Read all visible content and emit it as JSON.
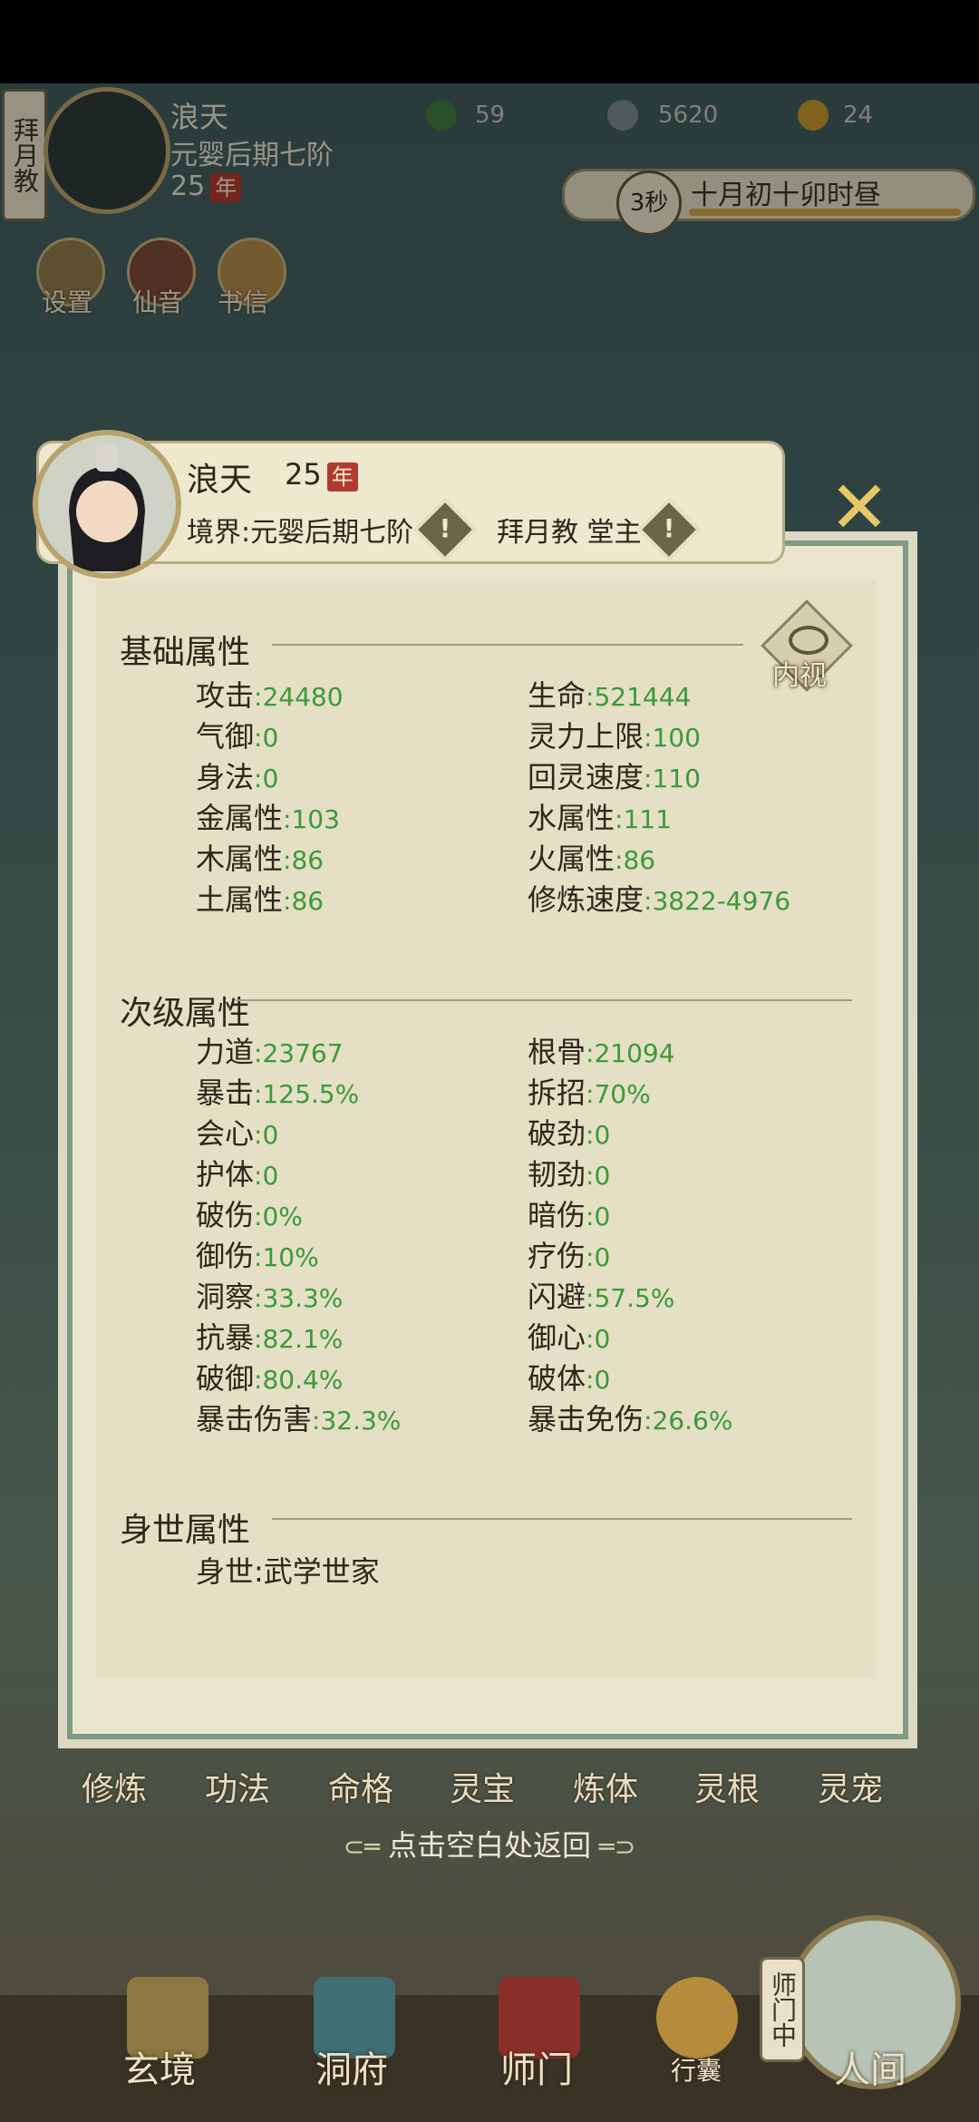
{
  "header": {
    "sect_tag": "拜月教",
    "name": "浪天",
    "realm": "元婴后期七阶",
    "age": "25",
    "age_unit": "年",
    "resources": [
      {
        "icon": "spirit-stone-icon",
        "value": "59"
      },
      {
        "icon": "coin-icon",
        "value": "5620"
      },
      {
        "icon": "strength-icon",
        "value": "24"
      }
    ],
    "time_badge": "3秒",
    "date_text": "十月初十卯时昼",
    "tools": [
      "设置",
      "仙音",
      "书信"
    ]
  },
  "profile": {
    "name": "浪天",
    "age": "25",
    "age_unit": "年",
    "realm_line": "境界:元婴后期七阶",
    "sect_line": "拜月教 堂主"
  },
  "basic": {
    "title": "基础属性",
    "neishi_label": "内视",
    "left": [
      {
        "label": "攻击",
        "value": ":24480"
      },
      {
        "label": "气御",
        "value": ":0"
      },
      {
        "label": "身法",
        "value": ":0"
      },
      {
        "label": "金属性",
        "value": ":103"
      },
      {
        "label": "木属性",
        "value": ":86"
      },
      {
        "label": "土属性",
        "value": ":86"
      }
    ],
    "right": [
      {
        "label": "生命",
        "value": ":521444"
      },
      {
        "label": "灵力上限",
        "value": ":100"
      },
      {
        "label": "回灵速度",
        "value": ":110"
      },
      {
        "label": "水属性",
        "value": ":111"
      },
      {
        "label": "火属性",
        "value": ":86"
      },
      {
        "label": "修炼速度",
        "value": ":3822-4976"
      }
    ]
  },
  "secondary": {
    "title": "次级属性",
    "left": [
      {
        "label": "力道",
        "value": ":23767"
      },
      {
        "label": "暴击",
        "value": ":125.5%"
      },
      {
        "label": "会心",
        "value": ":0"
      },
      {
        "label": "护体",
        "value": ":0"
      },
      {
        "label": "破伤",
        "value": ":0%"
      },
      {
        "label": "御伤",
        "value": ":10%"
      },
      {
        "label": "洞察",
        "value": ":33.3%"
      },
      {
        "label": "抗暴",
        "value": ":82.1%"
      },
      {
        "label": "破御",
        "value": ":80.4%"
      },
      {
        "label": "暴击伤害",
        "value": ":32.3%"
      }
    ],
    "right": [
      {
        "label": "根骨",
        "value": ":21094"
      },
      {
        "label": "拆招",
        "value": ":70%"
      },
      {
        "label": "破劲",
        "value": ":0"
      },
      {
        "label": "韧劲",
        "value": ":0"
      },
      {
        "label": "暗伤",
        "value": ":0"
      },
      {
        "label": "疗伤",
        "value": ":0"
      },
      {
        "label": "闪避",
        "value": ":57.5%"
      },
      {
        "label": "御心",
        "value": ":0"
      },
      {
        "label": "破体",
        "value": ":0"
      },
      {
        "label": "暴击免伤",
        "value": ":26.6%"
      }
    ]
  },
  "background": {
    "title": "身世属性",
    "left": [
      {
        "label": "身世",
        "value": ":武学世家"
      }
    ]
  },
  "tabs": [
    "修炼",
    "功法",
    "命格",
    "灵宝",
    "炼体",
    "灵根",
    "灵宠"
  ],
  "return_hint": "点击空白处返回",
  "nav": {
    "items": [
      "玄境",
      "洞府",
      "师门",
      "行囊",
      "人间"
    ],
    "side_tag": "师门中"
  },
  "colors": {
    "value_green": "#3a9a3a",
    "gold": "#e7c768",
    "panel_border": "#7f9a86"
  }
}
